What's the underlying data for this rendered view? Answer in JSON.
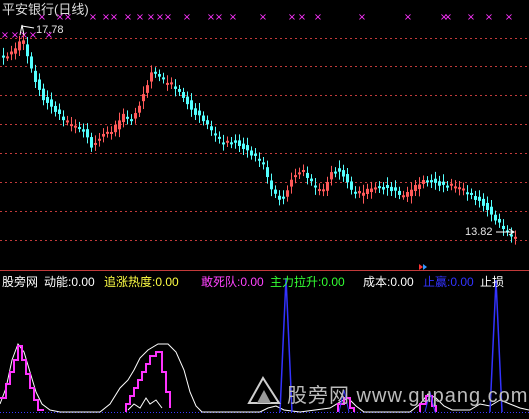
{
  "main_chart": {
    "title": "平安银行(日线)",
    "high_label": "17.78",
    "low_label": "13.82",
    "marker_glyph": "×",
    "colors": {
      "up": "#ff5a5a",
      "down": "#54ffff",
      "grid": "#c23a3a",
      "title": "#dcdcdc",
      "marker": "#ff33ff",
      "label": "#e6e6e6"
    }
  },
  "indicator_bar": {
    "name": "股旁网",
    "items": [
      {
        "label": "动能:",
        "value": "0.00",
        "color": "#ffffff"
      },
      {
        "label": "追涨热度:",
        "value": "0.00",
        "color": "#ffff44"
      },
      {
        "label": "敢死队:",
        "value": "0.00",
        "color": "#ff44ff"
      },
      {
        "label": "主力拉升:",
        "value": "0.00",
        "color": "#33ff33"
      },
      {
        "label": "成本:",
        "value": "0.00",
        "color": "#ffffff"
      },
      {
        "label": "止赢:",
        "value": "0.00",
        "color": "#3333ff"
      },
      {
        "label": "止损",
        "value": "",
        "color": "#ffffff"
      }
    ]
  },
  "watermark": {
    "text": "股旁网 www.gupang.com"
  }
}
